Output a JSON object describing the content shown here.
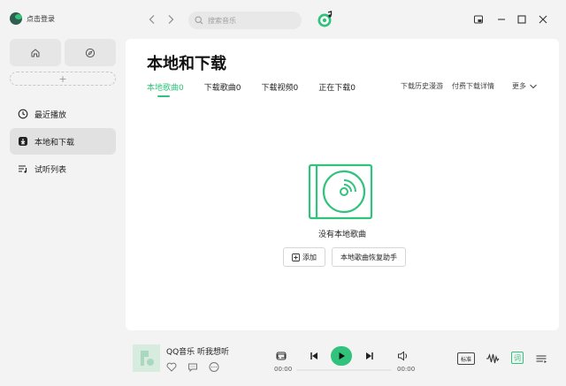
{
  "app": {
    "login_label": "点击登录",
    "accent": "#31c27c"
  },
  "sidebar": {
    "quick": [
      {
        "icon": "home-icon"
      },
      {
        "icon": "compass-icon"
      }
    ],
    "add_label": "+",
    "items": [
      {
        "label": "最近播放",
        "icon": "clock-icon",
        "active": false
      },
      {
        "label": "本地和下载",
        "icon": "download-icon",
        "active": true
      },
      {
        "label": "试听列表",
        "icon": "playlist-icon",
        "active": false
      }
    ]
  },
  "topbar": {
    "search_placeholder": "搜索音乐"
  },
  "page": {
    "title": "本地和下载",
    "tabs": [
      {
        "label": "本地歌曲0",
        "active": true
      },
      {
        "label": "下载歌曲0",
        "active": false
      },
      {
        "label": "下载视频0",
        "active": false
      },
      {
        "label": "正在下载0",
        "active": false
      }
    ],
    "links": {
      "history": "下载历史漫游",
      "paid": "付费下载详情",
      "more": "更多"
    },
    "empty_text": "没有本地歌曲",
    "add_button": "添加",
    "restore_button": "本地歌曲恢复助手"
  },
  "player": {
    "song_title": "QQ音乐 听我想听",
    "time_current": "00:00",
    "time_total": "00:00",
    "progress": 0,
    "quality_label": "标准",
    "lyric_label": "词"
  }
}
